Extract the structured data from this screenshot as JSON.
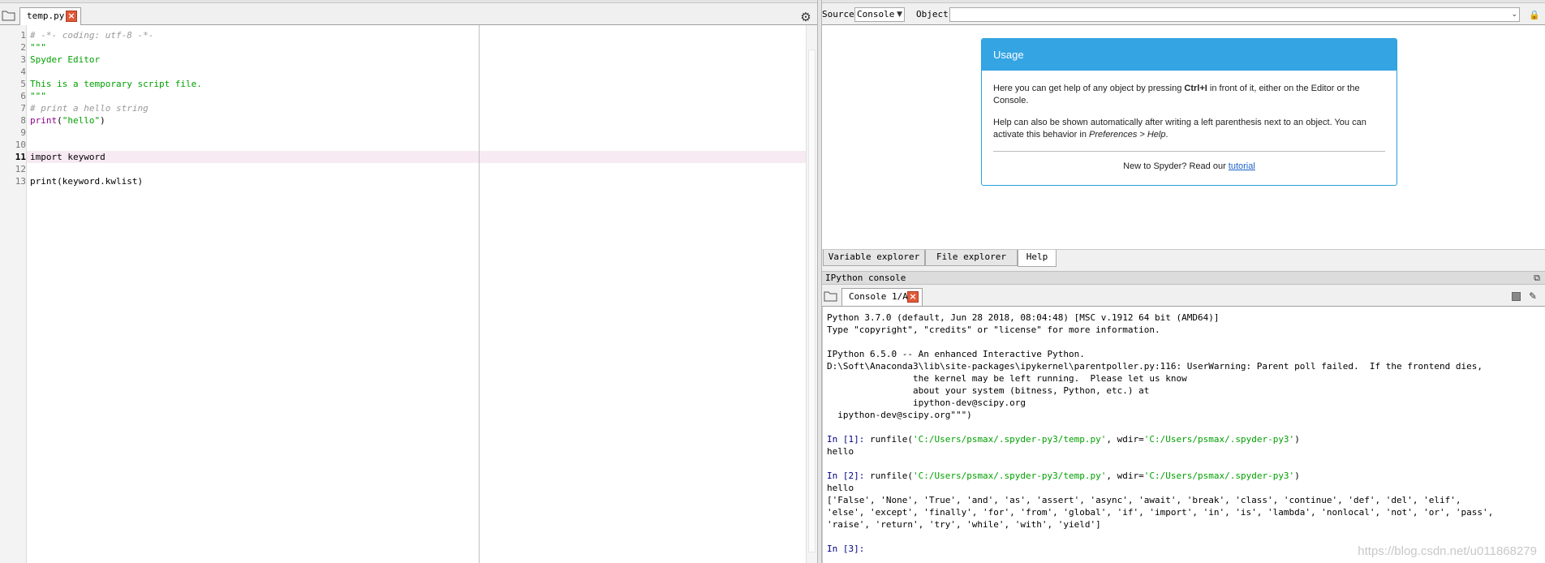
{
  "editor": {
    "tab_label": "temp.py",
    "line_numbers": [
      "1",
      "2",
      "3",
      "4",
      "5",
      "6",
      "7",
      "8",
      "9",
      "10",
      "11",
      "12",
      "13"
    ],
    "lines": {
      "l1": "# -*- coding: utf-8 -*-",
      "l2": "\"\"\"",
      "l3": "Spyder Editor",
      "l5": "This is a temporary script file.",
      "l6": "\"\"\"",
      "l7": "# print a hello string",
      "l8_fn": "print",
      "l8_open": "(",
      "l8_str": "\"hello\"",
      "l8_close": ")",
      "l11": "import keyword",
      "l13": "print(keyword.kwlist)"
    },
    "current_line": "11"
  },
  "help": {
    "source_label": "Source",
    "source_value": "Console",
    "object_label": "Object",
    "object_value": "",
    "usage": {
      "title": "Usage",
      "p1_a": "Here you can get help of any object by pressing ",
      "p1_key": "Ctrl+I",
      "p1_b": " in front of it, either on the Editor or the Console.",
      "p2_a": "Help can also be shown automatically after writing a left parenthesis next to an object. You can activate this behavior in ",
      "p2_em": "Preferences > Help",
      "p2_b": ".",
      "footer_text": "New to Spyder? Read our ",
      "footer_link": "tutorial"
    },
    "tabs": [
      "Variable explorer",
      "File explorer",
      "Help"
    ],
    "active_tab": "Help"
  },
  "console": {
    "pane_title": "IPython console",
    "tab_label": "Console 1/A",
    "lines": {
      "c1": "Python 3.7.0 (default, Jun 28 2018, 08:04:48) [MSC v.1912 64 bit (AMD64)]",
      "c2": "Type \"copyright\", \"credits\" or \"license\" for more information.",
      "c4": "IPython 6.5.0 -- An enhanced Interactive Python.",
      "c5": "D:\\Soft\\Anaconda3\\lib\\site-packages\\ipykernel\\parentpoller.py:116: UserWarning: Parent poll failed.  If the frontend dies,",
      "c6": "                the kernel may be left running.  Please let us know",
      "c7": "                about your system (bitness, Python, etc.) at",
      "c8": "                ipython-dev@scipy.org",
      "c9": "  ipython-dev@scipy.org\"\"\")",
      "p1": "In [1]: ",
      "p1_call": "runfile(",
      "p1_arg1": "'C:/Users/psmax/.spyder-py3/temp.py'",
      "p1_mid": ", wdir=",
      "p1_arg2": "'C:/Users/psmax/.spyder-py3'",
      "p1_end": ")",
      "o1": "hello",
      "p2": "In [2]: ",
      "p2_call": "runfile(",
      "p2_arg1": "'C:/Users/psmax/.spyder-py3/temp.py'",
      "p2_mid": ", wdir=",
      "p2_arg2": "'C:/Users/psmax/.spyder-py3'",
      "p2_end": ")",
      "o2": "hello",
      "k1": "['False', 'None', 'True', 'and', 'as', 'assert', 'async', 'await', 'break', 'class', 'continue', 'def', 'del', 'elif',",
      "k2": "'else', 'except', 'finally', 'for', 'from', 'global', 'if', 'import', 'in', 'is', 'lambda', 'nonlocal', 'not', 'or', 'pass',",
      "k3": "'raise', 'return', 'try', 'while', 'with', 'yield']",
      "p3": "In [3]: "
    },
    "watermark": "https://blog.csdn.net/u011868279"
  },
  "colors": {
    "usage_header": "#34a4e3",
    "string_green": "#00a000",
    "comment_grey": "#999999",
    "builtin_purple": "#900090",
    "current_line_bg": "#f7eaf3",
    "close_tab_red": "#e05a3a"
  }
}
